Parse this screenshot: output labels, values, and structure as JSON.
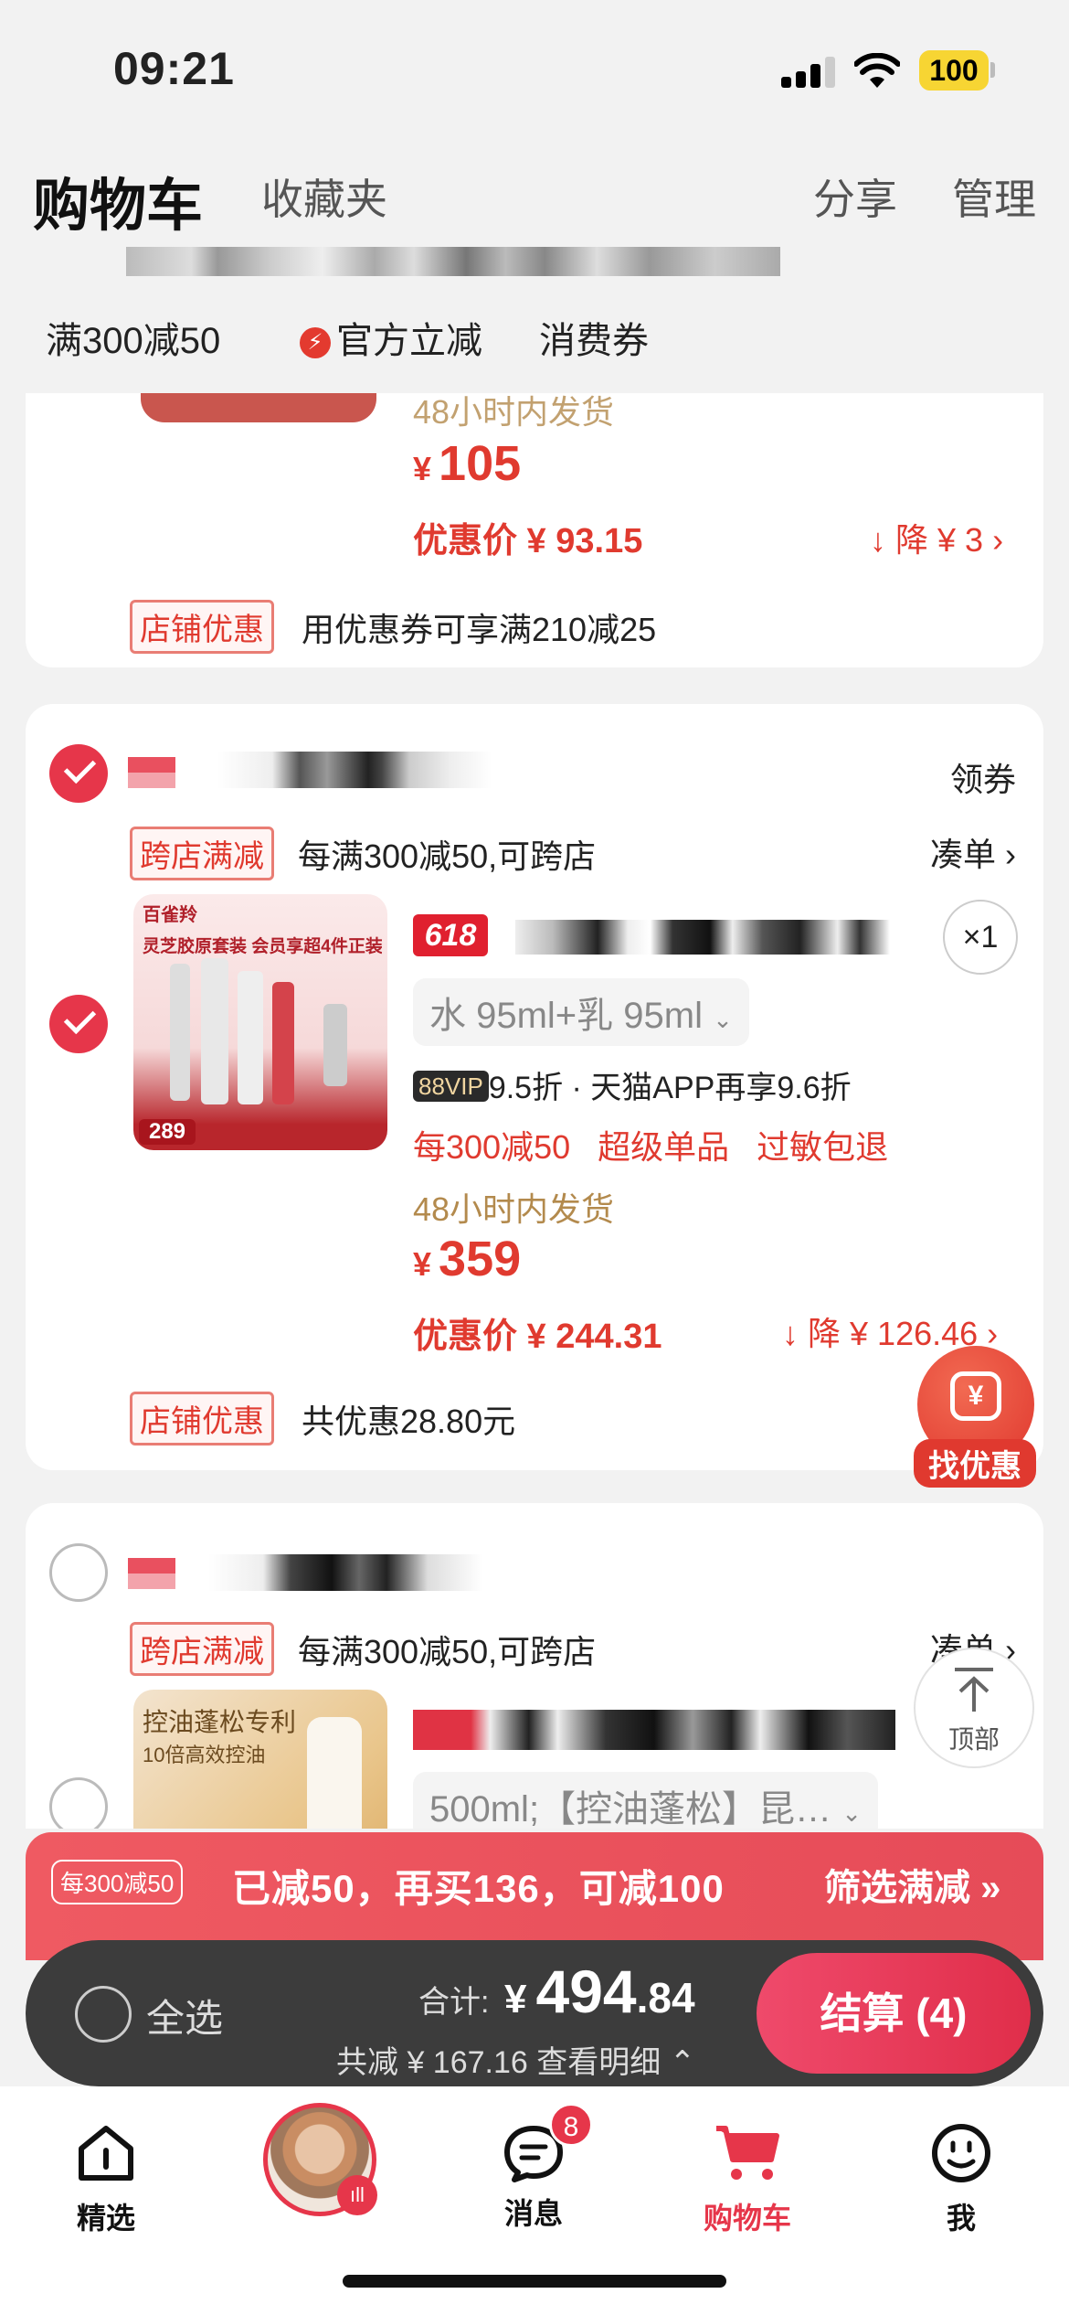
{
  "status": {
    "time": "09:21",
    "battery": "100"
  },
  "header": {
    "title": "购物车",
    "favorites": "收藏夹",
    "share": "分享",
    "manage": "管理"
  },
  "filters": [
    "满300减50",
    "官方立减",
    "消费券"
  ],
  "card1": {
    "ship": "48小时内发货",
    "price": "105",
    "yen": "¥",
    "disc_price": "优惠价 ¥ 93.15",
    "drop": "降 ¥ 3",
    "shop_tag": "店铺优惠",
    "shop_text": "用优惠券可享满210减25"
  },
  "card2": {
    "coupon": "领券",
    "cross_tag": "跨店满减",
    "cross_text": "每满300减50,可跨店",
    "cross_link": "凑单",
    "badge618": "618",
    "sku": "水 95ml+乳 95ml",
    "qty": "×1",
    "vip_tag": "88VIP",
    "vip_text": "9.5折 · 天猫APP再享9.6折",
    "promos": "每300减50   超级单品   过敏包退",
    "ship": "48小时内发货",
    "price": "359",
    "yen": "¥",
    "disc_price": "优惠价 ¥ 244.31",
    "drop": "降 ¥ 126.46",
    "shop_tag": "店铺优惠",
    "shop_text": "共优惠28.80元",
    "thumb_brand": "百雀羚",
    "thumb_title": "灵芝胶原套装  会员享超4件正装",
    "thumb_price": "289"
  },
  "card3": {
    "cross_tag": "跨店满减",
    "cross_text": "每满300减50,可跨店",
    "cross_link": "凑单",
    "sku": "500ml;【控油蓬松】昆…",
    "thumb_title": "控油蓬松专利",
    "thumb_sub": "10倍高效控油"
  },
  "floating": {
    "find_deal": "找优惠",
    "top": "顶部"
  },
  "promo": {
    "tag": "每300减50",
    "text": "已减50，再买136，可减100",
    "link": "筛选满减 »"
  },
  "checkout": {
    "select_all": "全选",
    "total_label": "合计:",
    "yen": "¥",
    "total_int": "494",
    "total_dec": ".84",
    "saved": "共减 ¥ 167.16  查看明细 ⌃",
    "button": "结算 (4)"
  },
  "tabs": [
    {
      "label": "精选",
      "icon": "home-icon"
    },
    {
      "label": "",
      "icon": "avatar"
    },
    {
      "label": "消息",
      "icon": "message-icon",
      "badge": "8"
    },
    {
      "label": "购物车",
      "icon": "cart-icon",
      "active": true
    },
    {
      "label": "我",
      "icon": "profile-icon"
    }
  ]
}
